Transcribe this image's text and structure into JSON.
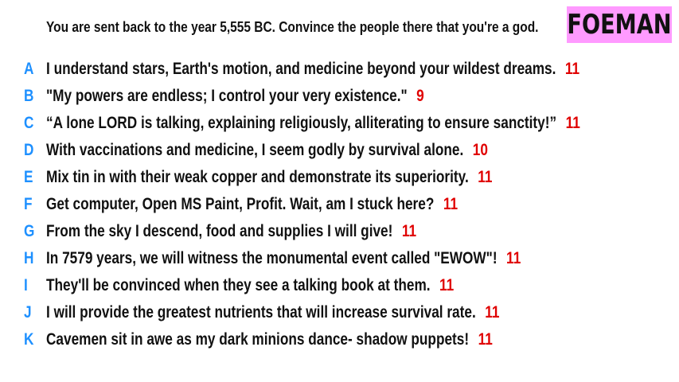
{
  "prompt": "You are sent back to the year 5,555 BC. Convince the people there that you're a god.",
  "badge": "FOEMAN",
  "colors": {
    "letter": "#1e90ff",
    "score": "#e00000",
    "badge_bg": "#ff9aff"
  },
  "answers": [
    {
      "letter": "A",
      "text": "I understand stars, Earth's motion, and medicine beyond your wildest dreams.",
      "score": "11"
    },
    {
      "letter": "B",
      "text": "\"My powers are endless; I control your very existence.\"",
      "score": "9"
    },
    {
      "letter": "C",
      "text": "“A lone LORD is talking, explaining religiously, alliterating to ensure sanctity!”",
      "score": "11"
    },
    {
      "letter": "D",
      "text": "With vaccinations and medicine, I seem godly by survival alone.",
      "score": "10"
    },
    {
      "letter": "E",
      "text": "Mix tin in with their weak copper and demonstrate its superiority.",
      "score": "11"
    },
    {
      "letter": "F",
      "text": "Get computer, Open MS Paint, Profit. Wait, am I stuck here?",
      "score": "11"
    },
    {
      "letter": "G",
      "text": "From the sky I descend, food and supplies I will give!",
      "score": "11"
    },
    {
      "letter": "H",
      "text": "In 7579 years, we will witness the monumental event called \"EWOW\"!",
      "score": "11"
    },
    {
      "letter": "I",
      "text": "They'll be convinced when they see a talking book at them.",
      "score": "11"
    },
    {
      "letter": "J",
      "text": "I will provide the greatest nutrients that will increase survival rate.",
      "score": "11"
    },
    {
      "letter": "K",
      "text": "Cavemen sit in awe as my dark minions dance- shadow puppets!",
      "score": "11"
    }
  ]
}
